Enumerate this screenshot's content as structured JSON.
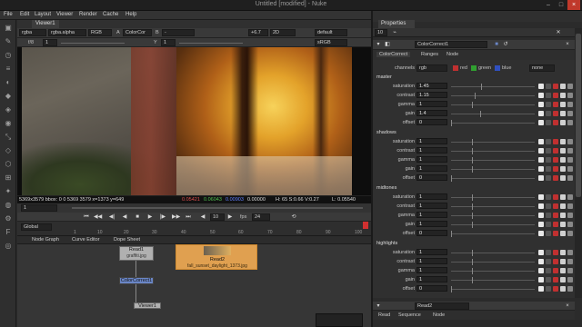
{
  "app": {
    "title": "Untitled [modified] - Nuke"
  },
  "menu": [
    "File",
    "Edit",
    "Layout",
    "Viewer",
    "Render",
    "Cache",
    "Help"
  ],
  "viewer": {
    "tab": "Viewer1",
    "channels": "rgba",
    "alpha": "rgba.alpha",
    "colorspace_display": "RGB",
    "input_a": "A",
    "input_a_node": "ColorCor",
    "input_b": "B",
    "gain_label": "f/8",
    "gain_value": "1",
    "gamma_label": "Y",
    "gamma_value": "1",
    "exposure": "+6.7",
    "mode": "2D",
    "format": "default",
    "lut": "sRGB",
    "info_coords": "5369x3579 bbox: 0 0 5369 3579  x=1373 y=649",
    "info_r": "0.05421",
    "info_g": "0.06043",
    "info_b": "0.00903",
    "info_a": "0.00000",
    "info_hsv": "H: 65 S:0.66 V:0.27",
    "info_l": "L: 0.05540"
  },
  "transport": {
    "frame": "1",
    "step": "10",
    "fps_label": "fps",
    "fps": "24",
    "range_mode": "Global",
    "ticks": [
      "1",
      "10",
      "20",
      "30",
      "40",
      "50",
      "60",
      "70",
      "80",
      "90",
      "100"
    ]
  },
  "nodegraph": {
    "tabs": [
      "Node Graph",
      "Curve Editor",
      "Dope Sheet"
    ],
    "nodes": {
      "read1": {
        "name": "Read1",
        "file": "graffiti.jpg"
      },
      "read2": {
        "name": "Read2",
        "file": "fall_sunset_daylight_1373.jpg"
      },
      "colorcorrect": {
        "name": "ColorCorrect1"
      },
      "viewer": {
        "name": "Viewer1"
      }
    }
  },
  "properties": {
    "title": "Properties",
    "max_panels": "10",
    "node_name": "ColorCorrect1",
    "tabs": [
      "ColorCorrect",
      "Ranges",
      "Node"
    ],
    "channels_label": "channels",
    "channels_value": "rgb",
    "channel_checks": [
      "red",
      "green",
      "blue"
    ],
    "channel_extra": "none",
    "sections": [
      {
        "name": "master",
        "rows": [
          {
            "label": "saturation",
            "value": "1.45"
          },
          {
            "label": "contrast",
            "value": "1.15"
          },
          {
            "label": "gamma",
            "value": "1"
          },
          {
            "label": "gain",
            "value": "1.4"
          },
          {
            "label": "offset",
            "value": "0"
          }
        ]
      },
      {
        "name": "shadows",
        "rows": [
          {
            "label": "saturation",
            "value": "1"
          },
          {
            "label": "contrast",
            "value": "1"
          },
          {
            "label": "gamma",
            "value": "1"
          },
          {
            "label": "gain",
            "value": "1"
          },
          {
            "label": "offset",
            "value": "0"
          }
        ]
      },
      {
        "name": "midtones",
        "rows": [
          {
            "label": "saturation",
            "value": "1"
          },
          {
            "label": "contrast",
            "value": "1"
          },
          {
            "label": "gamma",
            "value": "1"
          },
          {
            "label": "gain",
            "value": "1"
          },
          {
            "label": "offset",
            "value": "0"
          }
        ]
      },
      {
        "name": "highlights",
        "rows": [
          {
            "label": "saturation",
            "value": "1"
          },
          {
            "label": "contrast",
            "value": "1"
          },
          {
            "label": "gamma",
            "value": "1"
          },
          {
            "label": "gain",
            "value": "1"
          },
          {
            "label": "offset",
            "value": "0"
          }
        ]
      }
    ],
    "read2": {
      "name": "Read2",
      "tabs": [
        "Read",
        "Sequence",
        "Node"
      ]
    }
  },
  "colors": {
    "accent": "#f0a030",
    "viewer_bg": "#0d0d0d",
    "panel": "#303030"
  }
}
